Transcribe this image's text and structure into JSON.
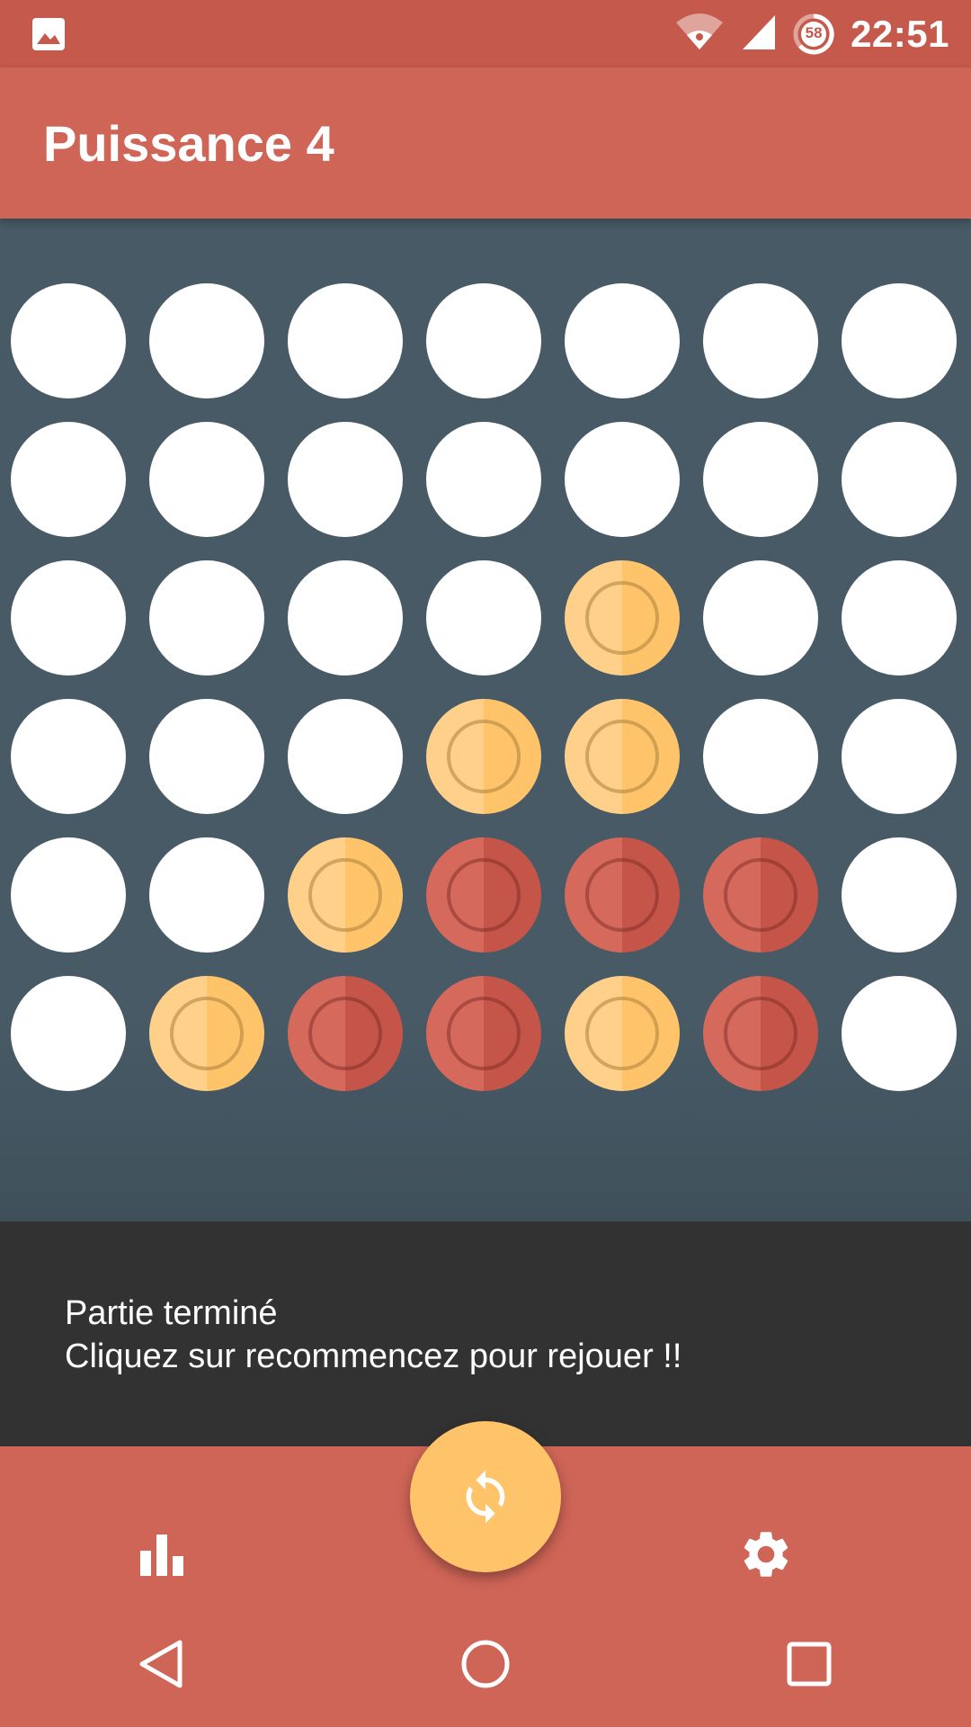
{
  "status_bar": {
    "time": "22:51",
    "battery_level": "58",
    "icons": [
      "image-icon",
      "wifi-icon",
      "signal-icon",
      "battery-icon"
    ]
  },
  "app_bar": {
    "title": "Puissance 4"
  },
  "board": {
    "rows": 6,
    "columns": 7,
    "cells": [
      [
        "empty",
        "empty",
        "empty",
        "empty",
        "empty",
        "empty",
        "empty"
      ],
      [
        "empty",
        "empty",
        "empty",
        "empty",
        "empty",
        "empty",
        "empty"
      ],
      [
        "empty",
        "empty",
        "empty",
        "empty",
        "yellow",
        "empty",
        "empty"
      ],
      [
        "empty",
        "empty",
        "empty",
        "yellow",
        "yellow",
        "empty",
        "empty"
      ],
      [
        "empty",
        "empty",
        "yellow",
        "red",
        "red",
        "red",
        "empty"
      ],
      [
        "empty",
        "yellow",
        "red",
        "red",
        "yellow",
        "red",
        "empty"
      ]
    ],
    "colors": {
      "empty": "#ffffff",
      "yellow": "#ffc46a",
      "red": "#c45548",
      "background": "#475a65"
    }
  },
  "snackbar": {
    "line1": "Partie terminé",
    "line2": "Cliquez sur recommencez pour rejouer !!"
  },
  "bottom_bar": {
    "stats_icon": "bar-chart-icon",
    "restart_icon": "refresh-icon",
    "settings_icon": "gear-icon",
    "accent": "#ffc46a",
    "background": "#cf6557"
  },
  "nav_bar": {
    "icons": [
      "back-icon",
      "home-icon",
      "recents-icon"
    ]
  }
}
